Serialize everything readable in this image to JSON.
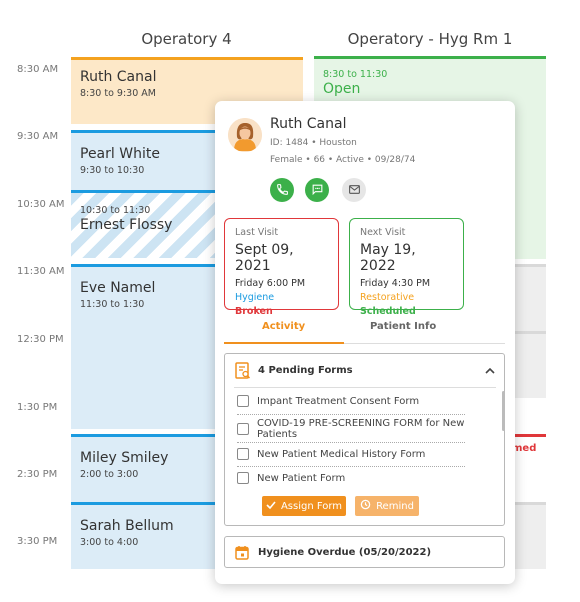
{
  "columns": [
    "Operatory 4",
    "Operatory - Hyg Rm 1"
  ],
  "times": [
    "8:30 AM",
    "9:30 AM",
    "10:30 AM",
    "11:30 AM",
    "12:30 PM",
    "1:30 PM",
    "2:30 PM",
    "3:30 PM"
  ],
  "appointments": {
    "ruth": {
      "name": "Ruth Canal",
      "time": "8:30 to 9:30 AM"
    },
    "pearl": {
      "name": "Pearl White",
      "time": "9:30 to 10:30"
    },
    "ernest": {
      "name": "Ernest Flossy",
      "time": "10:30 to 11:30"
    },
    "eve": {
      "name": "Eve Namel",
      "time": "11:30 to 1:30"
    },
    "miley": {
      "name": "Miley Smiley",
      "time": "2:00 to 3:00"
    },
    "sarah": {
      "name": "Sarah Bellum",
      "time": "3:00 to 4:00"
    },
    "open": {
      "time": "8:30 to 11:30",
      "label": "Open"
    },
    "partial": {
      "text": "med"
    }
  },
  "popup": {
    "name": "Ruth Canal",
    "id_line": "ID: 1484 • Houston",
    "info_line": "Female • 66 • Active • 09/28/74",
    "icons": {
      "phone": "phone-icon",
      "chat": "chat-icon",
      "mail": "mail-icon"
    },
    "last_visit": {
      "label": "Last Visit",
      "date": "Sept 09, 2021",
      "time": "Friday 6:00 PM",
      "type": "Hygiene",
      "status": "Broken"
    },
    "next_visit": {
      "label": "Next Visit",
      "date": "May 19, 2022",
      "time": "Friday 4:30 PM",
      "type": "Restorative",
      "status": "Scheduled"
    },
    "tabs": {
      "activity": "Activity",
      "patient_info": "Patient Info"
    },
    "forms": {
      "title": "4 Pending Forms",
      "items": [
        "Impant Treatment Consent Form",
        "COVID-19 PRE-SCREENING FORM for New Patients",
        "New Patient Medical History Form",
        "New Patient Form"
      ],
      "assign": "Assign Form",
      "remind": "Remind"
    },
    "hygiene": "Hygiene Overdue (05/20/2022)"
  },
  "colors": {
    "blue": "#1b9be0",
    "orange": "#f4a21f",
    "green": "#3cb04a",
    "red": "#e0373a",
    "button_orange": "#f0901e"
  }
}
